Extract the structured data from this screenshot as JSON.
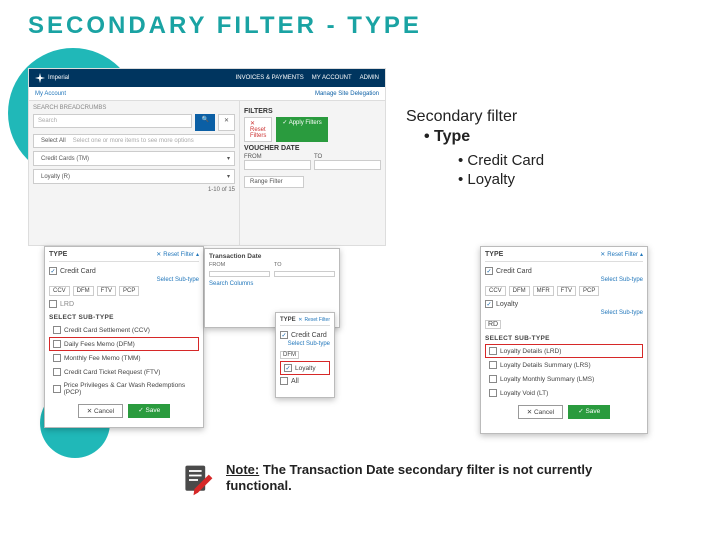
{
  "title": "SECONDARY FILTER - TYPE",
  "right": {
    "heading": "Secondary filter",
    "type": "Type",
    "opts": [
      "Credit Card",
      "Loyalty"
    ]
  },
  "note": {
    "lead": "Note:",
    "body_a": " The Transaction Date secondary filter is not currently ",
    "body_b": "functional."
  },
  "main": {
    "brand": "Imperial",
    "menu": [
      "INVOICES & PAYMENTS",
      "MY ACCOUNT",
      "ADMIN"
    ],
    "subbar_left": "My Account",
    "subbar_right": "Manage Site Delegation",
    "search_heading": "SEARCH BREADCRUMBS",
    "select_all": "Select All",
    "select_hint": "Select one or more items to see more options",
    "row1": "Credit Cards (TM)",
    "row2": "Loyalty (R)",
    "filters_label": "FILTERS",
    "reset_filters": "Reset Filters",
    "apply_filters": "Apply Filters",
    "vd_label": "VOUCHER DATE",
    "from": "FROM",
    "to": "TO",
    "range": "Range Filter",
    "search_ph": "Search",
    "paging": "1-10 of 15"
  },
  "popup1": {
    "title": "TYPE",
    "reset": "Reset Filter",
    "opt_top": "Credit Card",
    "sel_sub": "Select Sub-type",
    "codes": [
      "CCV",
      "DFM",
      "FTV",
      "PCP"
    ],
    "subhdr": "SELECT SUB-TYPE",
    "opts": [
      "Credit Card Settlement (CCV)",
      "Daily Fees Memo (DFM)",
      "Monthly Fee Memo (TMM)",
      "Credit Card Ticket Request (FTV)",
      "Price Privileges & Car Wash Redemptions (PCP)"
    ],
    "highlight_index": 1,
    "lrd": "LRD",
    "cancel": "Cancel",
    "save": "Save"
  },
  "td": {
    "title": "Transaction Date",
    "from": "FROM",
    "to": "TO",
    "search": "Search Columns"
  },
  "popup2": {
    "title": "TYPE",
    "reset": "Reset Filter",
    "cc": "Credit Card",
    "sel_sub": "Select Sub-type",
    "dfm": "DFM",
    "loyalty": "Loyalty",
    "all": "All"
  },
  "popup3": {
    "title": "TYPE",
    "reset": "Reset Filter",
    "opt_cc": "Credit Card",
    "sel_sub1": "Select Sub-type",
    "codes": [
      "CCV",
      "DFM",
      "MFR",
      "FTV",
      "PCP"
    ],
    "loyalty": "Loyalty",
    "sel_sub2": "Select Sub-type",
    "rd": "RD",
    "subhdr": "SELECT SUB-TYPE",
    "opts": [
      "Loyalty Details (LRD)",
      "Loyalty Details Summary (LRS)",
      "Loyalty Monthly Summary (LMS)",
      "Loyalty Void (LT)"
    ],
    "highlight_index": 0,
    "cancel": "Cancel",
    "save": "Save"
  }
}
